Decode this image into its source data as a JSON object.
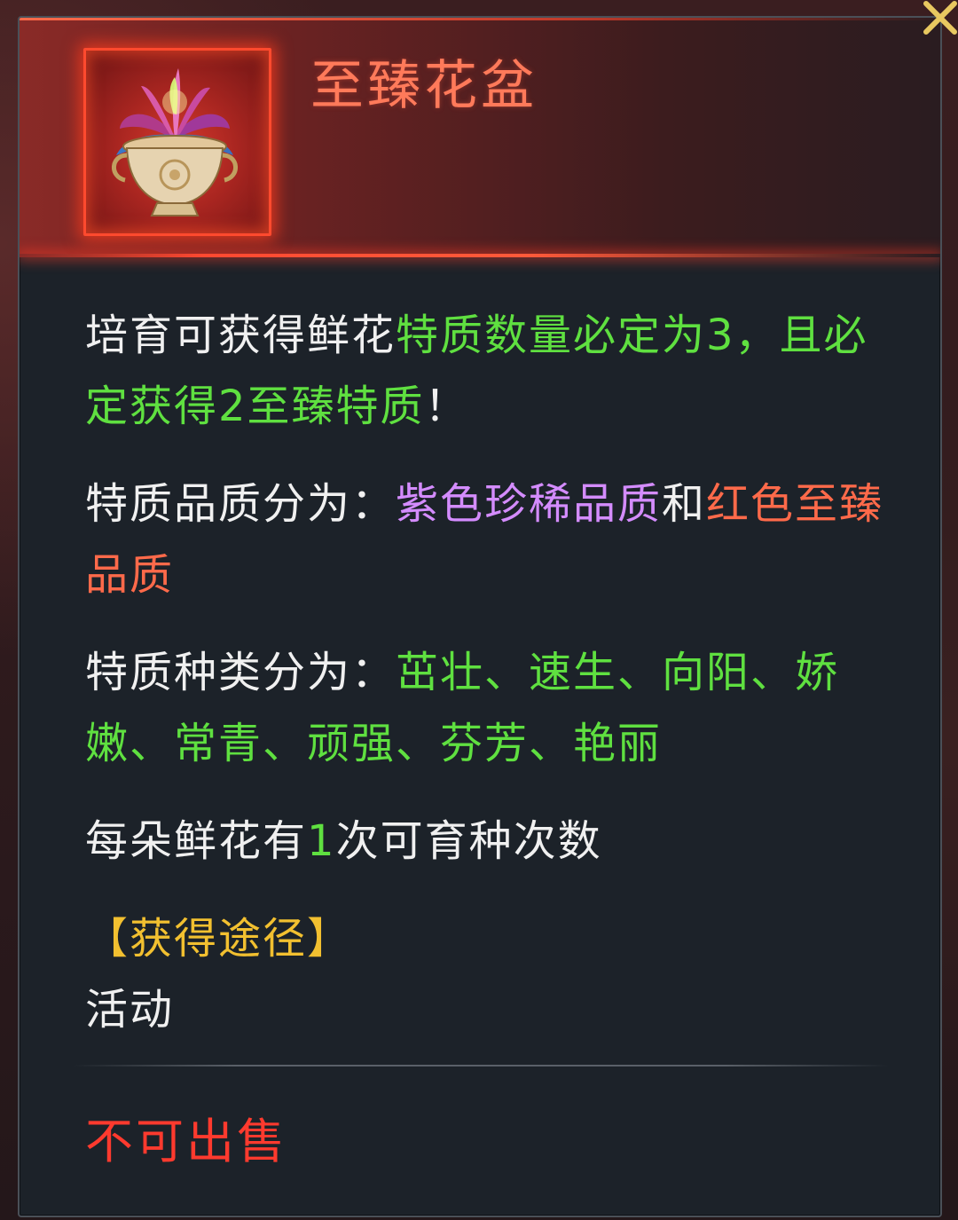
{
  "item": {
    "name": "至臻花盆",
    "icon": "flower-pot-icon"
  },
  "description": {
    "p1": {
      "t1": "培育可获得鲜花",
      "t2": "特质数量必定为3，且必定获得2至臻特质",
      "t3": "！"
    },
    "p2": {
      "t1": "特质品质分为：",
      "t2": "紫色珍稀品质",
      "t3": "和",
      "t4": "红色至臻品质"
    },
    "p3": {
      "t1": "特质种类分为：",
      "t2": "茁壮、速生、向阳、娇嫩、常青、顽强、芬芳、艳丽"
    },
    "p4": {
      "t1": "每朵鲜花有",
      "t2": "1",
      "t3": "次可育种次数"
    }
  },
  "source": {
    "title": "【获得途径】",
    "value": "活动"
  },
  "footer": {
    "sell_status": "不可出售"
  },
  "colors": {
    "title": "#ff7a5a",
    "highlight_green": "#5fe040",
    "purple_quality": "#d48cff",
    "red_quality": "#ff6a4a",
    "source_title": "#f2c030",
    "sell_status": "#ff3a2e"
  }
}
